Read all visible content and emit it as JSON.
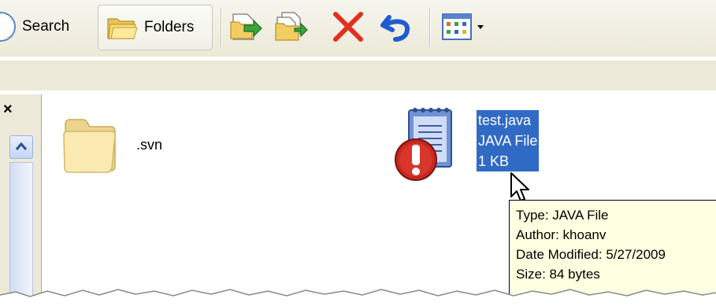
{
  "toolbar": {
    "search_label": "Search",
    "folders_label": "Folders",
    "icons": [
      "move-to-icon",
      "copy-to-icon",
      "delete-icon",
      "undo-icon",
      "views-icon"
    ]
  },
  "left_pane": {
    "close_glyph": "×"
  },
  "content": {
    "items": [
      {
        "name": ".svn",
        "icon": "folder-icon"
      },
      {
        "name": "test.java",
        "type": "JAVA File",
        "size": "1 KB",
        "icon": "notepad-icon",
        "overlay": "svn-conflict-icon",
        "selected": true
      }
    ]
  },
  "tooltip": {
    "type": "Type: JAVA File",
    "author": "Author: khoanv",
    "date_modified": "Date Modified: 5/27/2009",
    "size": "Size: 84 bytes"
  },
  "colors": {
    "selection": "#316ac5",
    "tooltip_bg": "#ffffe1",
    "toolbar_bg": "#ece9d8",
    "delete_red": "#e0301e",
    "undo_blue": "#1f5bd1"
  }
}
